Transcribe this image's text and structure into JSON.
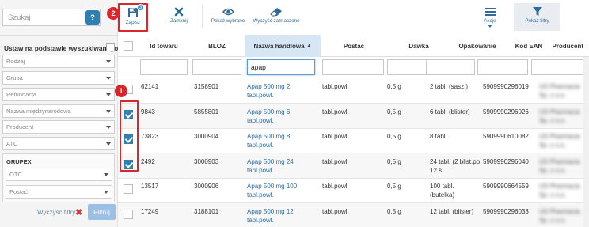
{
  "sidebar": {
    "search_placeholder": "Szukaj",
    "search_button_glyph": "?",
    "set_on_base_label": "Ustaw na podstawie wyszukiwanego towaru",
    "filters": [
      "Rodzaj",
      "Grupa",
      "Refundacja",
      "Nazwa międzynarodowa",
      "Producent",
      "ATC"
    ],
    "grupex": {
      "title": "GRUPEX",
      "filters": [
        "OTC",
        "Postać"
      ]
    },
    "clear_filters_label": "Wyczyść filtry",
    "clear_icon": "close-icon",
    "filter_button_label": "Filtruj"
  },
  "toolbar": {
    "save_label": "Zapisz",
    "save_count": "3",
    "close_label": "Zamknij",
    "show_selected_label": "Pokaż wybrane",
    "clear_selected_label": "Wyczyść zaznaczone",
    "actions_label": "Akcje",
    "show_filters_label": "Pokaż filtry",
    "step_badge": "2"
  },
  "table": {
    "step_badge": "1",
    "columns": [
      "Id towaru",
      "BLOZ",
      "Nazwa handlowa",
      "Postać",
      "Dawka",
      "Opakowanie",
      "Kod EAN",
      "Producent"
    ],
    "sorted_column": "Nazwa handlowa",
    "name_filter_value": "apap",
    "rows": [
      {
        "checked": false,
        "id": "62141",
        "bloz": "3158901",
        "name": "Apap 500 mg 2 tabl.powl.",
        "form": "tabl.powl.",
        "dose": "0,5 g",
        "pack": "2 tabl. (sasz.)",
        "ean": "5909990296019",
        "producer": "US Pharmacia Sp. z o.o."
      },
      {
        "checked": true,
        "id": "9843",
        "bloz": "5855801",
        "name": "Apap 500 mg 6 tabl.powl.",
        "form": "tabl.powl.",
        "dose": "0,5 g",
        "pack": "6 tabl. (blister)",
        "ean": "5909990296026",
        "producer": "US Pharmacia Sp. z o.o."
      },
      {
        "checked": true,
        "id": "73823",
        "bloz": "3000904",
        "name": "Apap 500 mg 8 tabl.powl.",
        "form": "tabl.powl.",
        "dose": "0,5 g",
        "pack": "8 tabl.",
        "ean": "5909990610082",
        "producer": "US Pharmacia Sp. z o.o."
      },
      {
        "checked": true,
        "id": "2492",
        "bloz": "3000903",
        "name": "Apap 500 mg 24 tabl.powl.",
        "form": "tabl.powl.",
        "dose": "0,5 g",
        "pack": "24 tabl. (2 blist.po 12 s",
        "ean": "5909990296040",
        "producer": "US Pharmacia Sp. z o.o."
      },
      {
        "checked": false,
        "id": "13517",
        "bloz": "3000906",
        "name": "Apap 500 mg 100 tabl.powl.",
        "form": "tabl.powl.",
        "dose": "0,5 g",
        "pack": "100 tabl. (butelka)",
        "ean": "5909990664559",
        "producer": "US Pharmacia Sp. z o.o."
      },
      {
        "checked": false,
        "id": "17249",
        "bloz": "3188101",
        "name": "Apap 500 mg 12 tabl.powl.",
        "form": "tabl.powl.",
        "dose": "0,5 g",
        "pack": "12 tabl. (blister)",
        "ean": "5909990296033",
        "producer": "US Pharmacia Sp. z o.o."
      }
    ]
  },
  "colors": {
    "accent_blue": "#2f7fb3",
    "link_blue": "#2f6fa3",
    "highlight_red": "#d9252c",
    "sorted_header": "#d6e6f4"
  }
}
